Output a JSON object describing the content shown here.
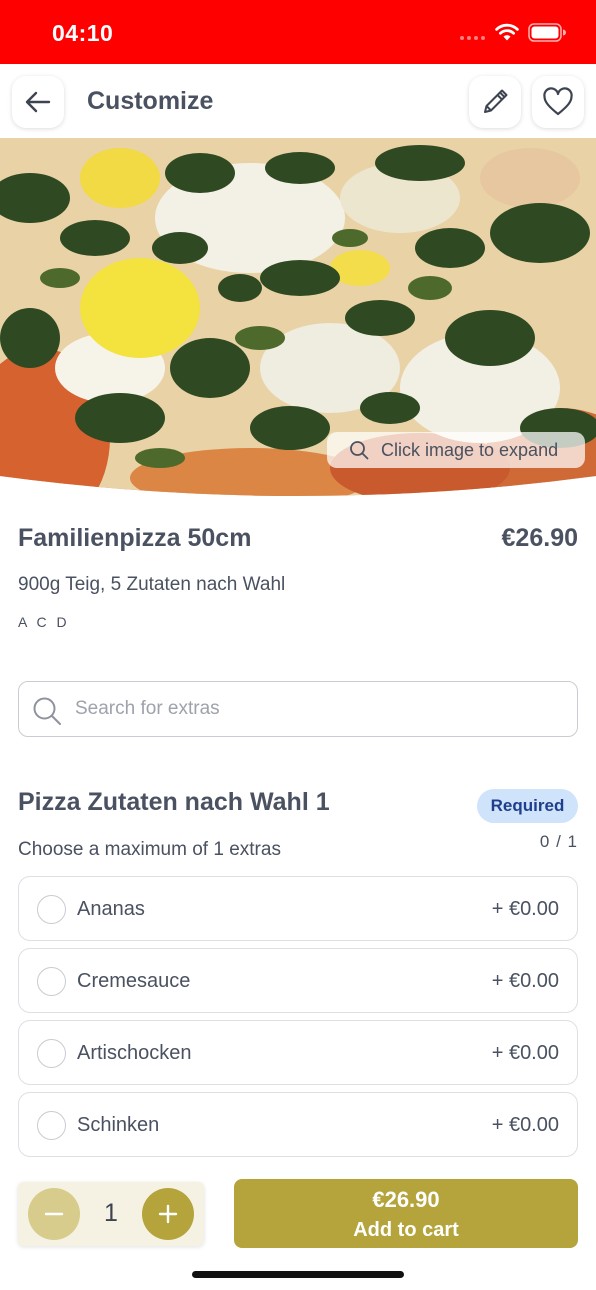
{
  "status_bar": {
    "time": "04:10",
    "background": "#ff0000"
  },
  "header": {
    "title": "Customize",
    "back_icon": "arrow-left-icon",
    "edit_icon": "pencil-icon",
    "favorite_icon": "heart-icon"
  },
  "hero": {
    "expand_hint": "Click image to expand",
    "hint_icon": "search-icon"
  },
  "product": {
    "name": "Familienpizza 50cm",
    "price": "€26.90",
    "description": "900g Teig, 5 Zutaten nach Wahl",
    "allergens": "A C D"
  },
  "search": {
    "placeholder": "Search for extras",
    "value": ""
  },
  "group": {
    "title": "Pizza Zutaten nach Wahl 1",
    "badge": "Required",
    "count": "0 / 1",
    "subtitle": "Choose a maximum of 1 extras",
    "options": [
      {
        "label": "Ananas",
        "price": "+ €0.00",
        "selected": false
      },
      {
        "label": "Cremesauce",
        "price": "+ €0.00",
        "selected": false
      },
      {
        "label": "Artischocken",
        "price": "+ €0.00",
        "selected": false
      },
      {
        "label": "Schinken",
        "price": "+ €0.00",
        "selected": false
      }
    ]
  },
  "footer": {
    "quantity": "1",
    "cart_price": "€26.90",
    "cart_label": "Add to cart",
    "accent": "#b5a43c"
  }
}
